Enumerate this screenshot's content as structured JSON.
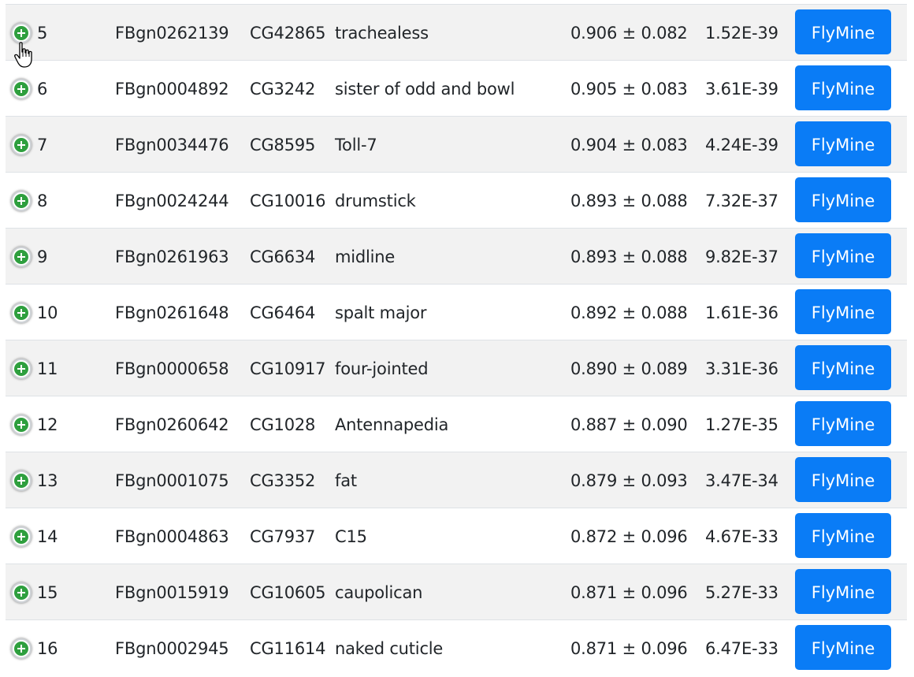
{
  "rows": [
    {
      "num": "5",
      "fbgn": "FBgn0262139",
      "cg": "CG42865",
      "name": "trachealess",
      "score": "0.906 ± 0.082",
      "pval": "1.52E-39",
      "button": "FlyMine"
    },
    {
      "num": "6",
      "fbgn": "FBgn0004892",
      "cg": "CG3242",
      "name": "sister of odd and bowl",
      "score": "0.905 ± 0.083",
      "pval": "3.61E-39",
      "button": "FlyMine"
    },
    {
      "num": "7",
      "fbgn": "FBgn0034476",
      "cg": "CG8595",
      "name": "Toll-7",
      "score": "0.904 ± 0.083",
      "pval": "4.24E-39",
      "button": "FlyMine"
    },
    {
      "num": "8",
      "fbgn": "FBgn0024244",
      "cg": "CG10016",
      "name": "drumstick",
      "score": "0.893 ± 0.088",
      "pval": "7.32E-37",
      "button": "FlyMine"
    },
    {
      "num": "9",
      "fbgn": "FBgn0261963",
      "cg": "CG6634",
      "name": "midline",
      "score": "0.893 ± 0.088",
      "pval": "9.82E-37",
      "button": "FlyMine"
    },
    {
      "num": "10",
      "fbgn": "FBgn0261648",
      "cg": "CG6464",
      "name": "spalt major",
      "score": "0.892 ± 0.088",
      "pval": "1.61E-36",
      "button": "FlyMine"
    },
    {
      "num": "11",
      "fbgn": "FBgn0000658",
      "cg": "CG10917",
      "name": "four-jointed",
      "score": "0.890 ± 0.089",
      "pval": "3.31E-36",
      "button": "FlyMine"
    },
    {
      "num": "12",
      "fbgn": "FBgn0260642",
      "cg": "CG1028",
      "name": "Antennapedia",
      "score": "0.887 ± 0.090",
      "pval": "1.27E-35",
      "button": "FlyMine"
    },
    {
      "num": "13",
      "fbgn": "FBgn0001075",
      "cg": "CG3352",
      "name": "fat",
      "score": "0.879 ± 0.093",
      "pval": "3.47E-34",
      "button": "FlyMine"
    },
    {
      "num": "14",
      "fbgn": "FBgn0004863",
      "cg": "CG7937",
      "name": "C15",
      "score": "0.872 ± 0.096",
      "pval": "4.67E-33",
      "button": "FlyMine"
    },
    {
      "num": "15",
      "fbgn": "FBgn0015919",
      "cg": "CG10605",
      "name": "caupolican",
      "score": "0.871 ± 0.096",
      "pval": "5.27E-33",
      "button": "FlyMine"
    },
    {
      "num": "16",
      "fbgn": "FBgn0002945",
      "cg": "CG11614",
      "name": "naked cuticle",
      "score": "0.871 ± 0.096",
      "pval": "6.47E-33",
      "button": "FlyMine"
    }
  ],
  "colors": {
    "stripe": "#f2f2f2",
    "button": "#0a7cf6",
    "expand": "#2e9f3e"
  },
  "icons": {
    "expand": "plus-circle-icon",
    "cursor": "hand-pointer-icon"
  }
}
